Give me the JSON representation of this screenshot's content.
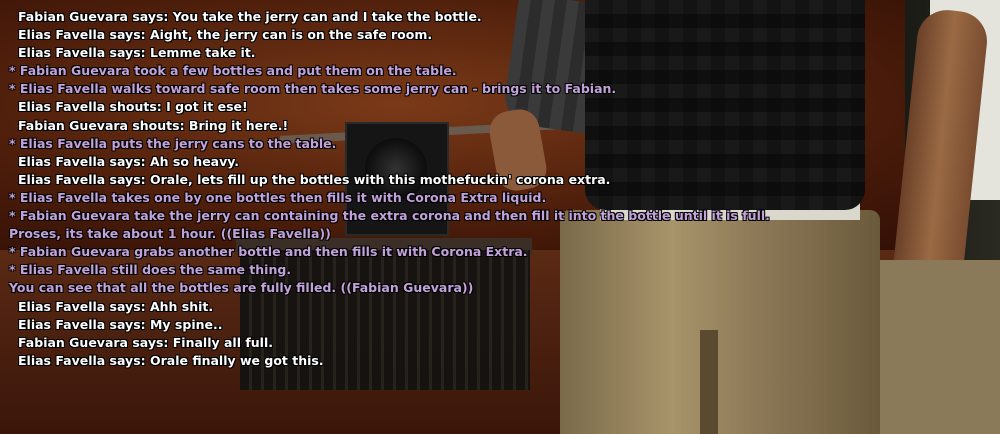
{
  "chat": {
    "lines": [
      {
        "text": "Fabian Guevara says: You take the jerry can and I take the bottle.",
        "kind": "say"
      },
      {
        "text": "Elias Favella says: Aight, the jerry can is on the safe room.",
        "kind": "say"
      },
      {
        "text": "Elias Favella says: Lemme take it.",
        "kind": "say"
      },
      {
        "text": "* Fabian Guevara took a few bottles and put them on the table.",
        "kind": "me"
      },
      {
        "text": "* Elias Favella walks toward safe room then takes some jerry can - brings it to Fabian.",
        "kind": "me"
      },
      {
        "text": "Elias Favella shouts: I got it ese!",
        "kind": "say"
      },
      {
        "text": "Fabian Guevara shouts: Bring it here.!",
        "kind": "say"
      },
      {
        "text": "* Elias Favella puts the jerry cans to the table.",
        "kind": "me"
      },
      {
        "text": "Elias Favella says: Ah so heavy.",
        "kind": "say"
      },
      {
        "text": "Elias Favella says: Orale, lets fill up the bottles with this mothefuckin' corona extra.",
        "kind": "say"
      },
      {
        "text": "* Elias Favella takes one by one bottles then fills it with Corona Extra liquid.",
        "kind": "me"
      },
      {
        "text": "* Fabian Guevara take the jerry can containing the extra corona and then fill it into the bottle until it is full.",
        "kind": "me"
      },
      {
        "text": "Proses, its take about 1 hour. ((Elias Favella))",
        "kind": "do"
      },
      {
        "text": "* Fabian Guevara grabs another bottle and then fills it with Corona Extra.",
        "kind": "me"
      },
      {
        "text": "* Elias Favella still does the same thing.",
        "kind": "me"
      },
      {
        "text": "You can see that all the bottles are fully filled. ((Fabian Guevara))",
        "kind": "do"
      },
      {
        "text": "Elias Favella says: Ahh shit.",
        "kind": "say"
      },
      {
        "text": "Elias Favella says: My spine..",
        "kind": "say"
      },
      {
        "text": "Fabian Guevara says: Finally all full.",
        "kind": "say"
      },
      {
        "text": "Elias Favella says: Orale finally we got this.",
        "kind": "say"
      }
    ]
  },
  "colors": {
    "say": "#ffffff",
    "action": "#c2a2da"
  }
}
